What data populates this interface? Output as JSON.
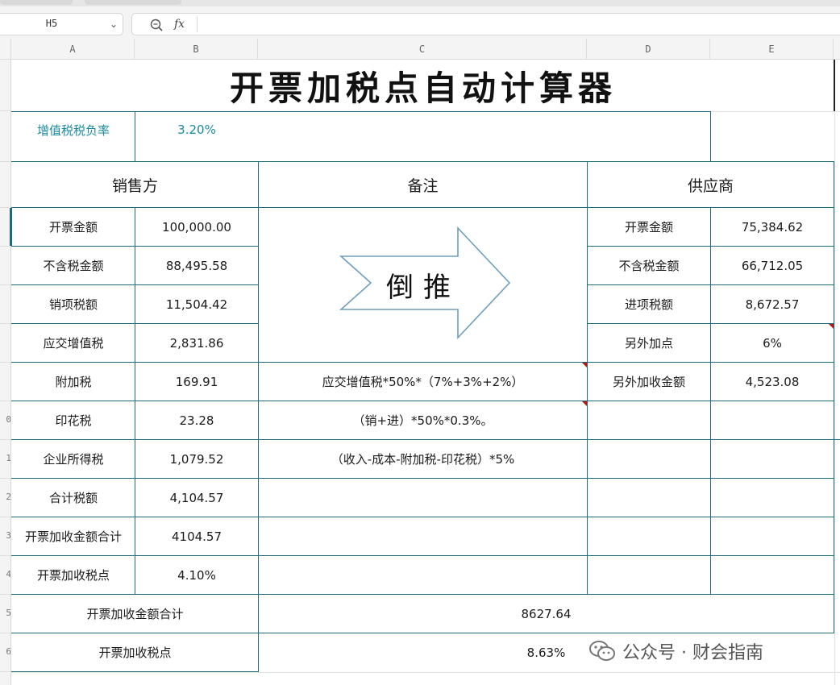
{
  "formula_bar": {
    "cell_ref": "H5",
    "fx_label": "fx",
    "formula": ""
  },
  "columns": [
    "A",
    "B",
    "C",
    "D",
    "E"
  ],
  "rows": [
    "",
    "",
    "",
    "",
    "",
    "",
    "",
    "",
    "",
    "0",
    "1",
    "2",
    "3",
    "4",
    "5",
    "6"
  ],
  "sheet": {
    "title": "开票加税点自动计算器",
    "vat_rate": {
      "label": "增值税税负率",
      "value": "3.20%"
    },
    "headers": {
      "seller": "销售方",
      "notes": "备注",
      "supplier": "供应商"
    },
    "seller_rows": [
      {
        "label": "开票金额",
        "value": "100,000.00"
      },
      {
        "label": "不含税金额",
        "value": "88,495.58"
      },
      {
        "label": "销项税额",
        "value": "11,504.42"
      },
      {
        "label": "应交增值税",
        "value": "2,831.86"
      },
      {
        "label": "附加税",
        "value": "169.91"
      },
      {
        "label": "印花税",
        "value": "23.28"
      },
      {
        "label": "企业所得税",
        "value": "1,079.52"
      },
      {
        "label": "合计税额",
        "value": "4,104.57"
      },
      {
        "label": "开票加收金额合计",
        "value": "4104.57"
      },
      {
        "label": "开票加收税点",
        "value": "4.10%"
      }
    ],
    "notes": {
      "arrow_text": "倒推",
      "surcharge": "应交增值税*50%*（7%+3%+2%）",
      "stamp": "（销+进）*50%*0.3%。",
      "income": "（收入-成本-附加税-印花税）*5%"
    },
    "supplier_rows": [
      {
        "label": "开票金额",
        "value": "75,384.62"
      },
      {
        "label": "不含税金额",
        "value": "66,712.05"
      },
      {
        "label": "进项税额",
        "value": "8,672.57"
      },
      {
        "label": "另外加点",
        "value": "6%"
      },
      {
        "label": "另外加收金额",
        "value": "4,523.08"
      }
    ],
    "totals": [
      {
        "label": "开票加收金额合计",
        "value": "8627.64"
      },
      {
        "label": "开票加收税点",
        "value": "8.63%"
      }
    ]
  },
  "watermark": "公众号 · 财会指南",
  "colors": {
    "grid": "#1e6b79",
    "accent_text": "#1b8aa0",
    "comment_marker": "#b01818"
  }
}
